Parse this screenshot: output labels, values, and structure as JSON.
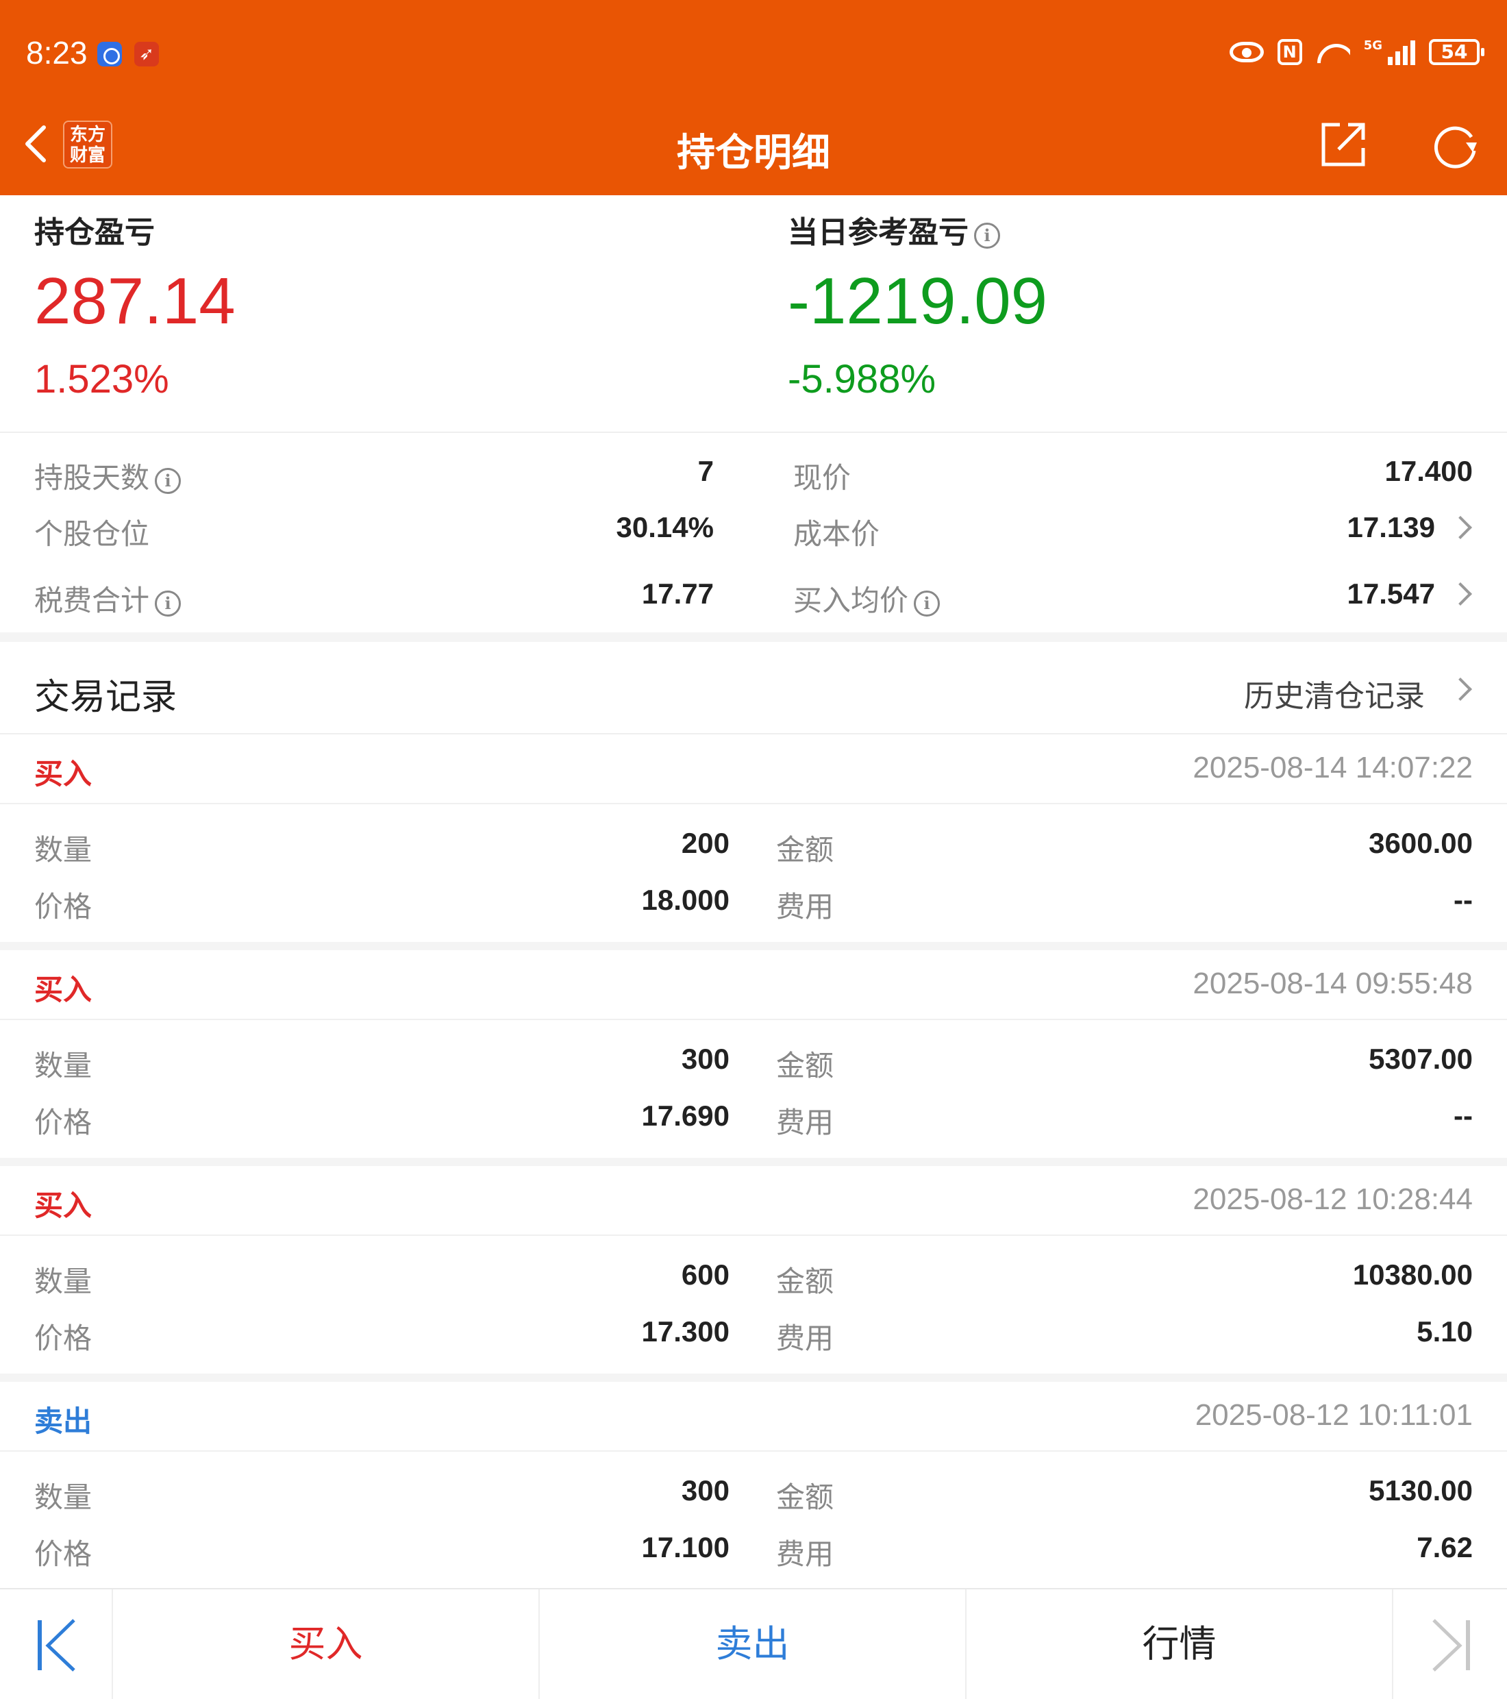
{
  "status_bar": {
    "time": "8:23",
    "signal_label": "5G",
    "battery": "54"
  },
  "header": {
    "logo_text": "东方财富",
    "title": "持仓明细"
  },
  "summary": {
    "position_pl_label": "持仓盈亏",
    "position_pl_value": "287.14",
    "position_pl_pct": "1.523%",
    "daily_pl_label": "当日参考盈亏",
    "daily_pl_value": "-1219.09",
    "daily_pl_pct": "-5.988%"
  },
  "details": {
    "hold_days_label": "持股天数",
    "hold_days": "7",
    "position_ratio_label": "个股仓位",
    "position_ratio": "30.14%",
    "tax_fee_label": "税费合计",
    "tax_fee": "17.77",
    "current_price_label": "现价",
    "current_price": "17.400",
    "cost_price_label": "成本价",
    "cost_price": "17.139",
    "avg_buy_price_label": "买入均价",
    "avg_buy_price": "17.547"
  },
  "trades": {
    "title": "交易记录",
    "history_link": "历史清仓记录",
    "labels": {
      "qty": "数量",
      "price": "价格",
      "amount": "金额",
      "fee": "费用"
    },
    "records": [
      {
        "type": "买入",
        "side": "buy",
        "time": "2025-08-14 14:07:22",
        "qty": "200",
        "price": "18.000",
        "amount": "3600.00",
        "fee": "--"
      },
      {
        "type": "买入",
        "side": "buy",
        "time": "2025-08-14 09:55:48",
        "qty": "300",
        "price": "17.690",
        "amount": "5307.00",
        "fee": "--"
      },
      {
        "type": "买入",
        "side": "buy",
        "time": "2025-08-12 10:28:44",
        "qty": "600",
        "price": "17.300",
        "amount": "10380.00",
        "fee": "5.10"
      },
      {
        "type": "卖出",
        "side": "sell",
        "time": "2025-08-12 10:11:01",
        "qty": "300",
        "price": "17.100",
        "amount": "5130.00",
        "fee": "7.62"
      }
    ]
  },
  "bottom_bar": {
    "buy": "买入",
    "sell": "卖出",
    "market": "行情"
  },
  "colors": {
    "brand": "#E95504",
    "up": "#E02828",
    "down": "#0E9C1E",
    "sell": "#2E7DD8"
  },
  "icons": [
    "back-icon",
    "share-icon",
    "refresh-icon",
    "info-icon",
    "chevron-right-icon",
    "first-icon",
    "last-icon"
  ]
}
